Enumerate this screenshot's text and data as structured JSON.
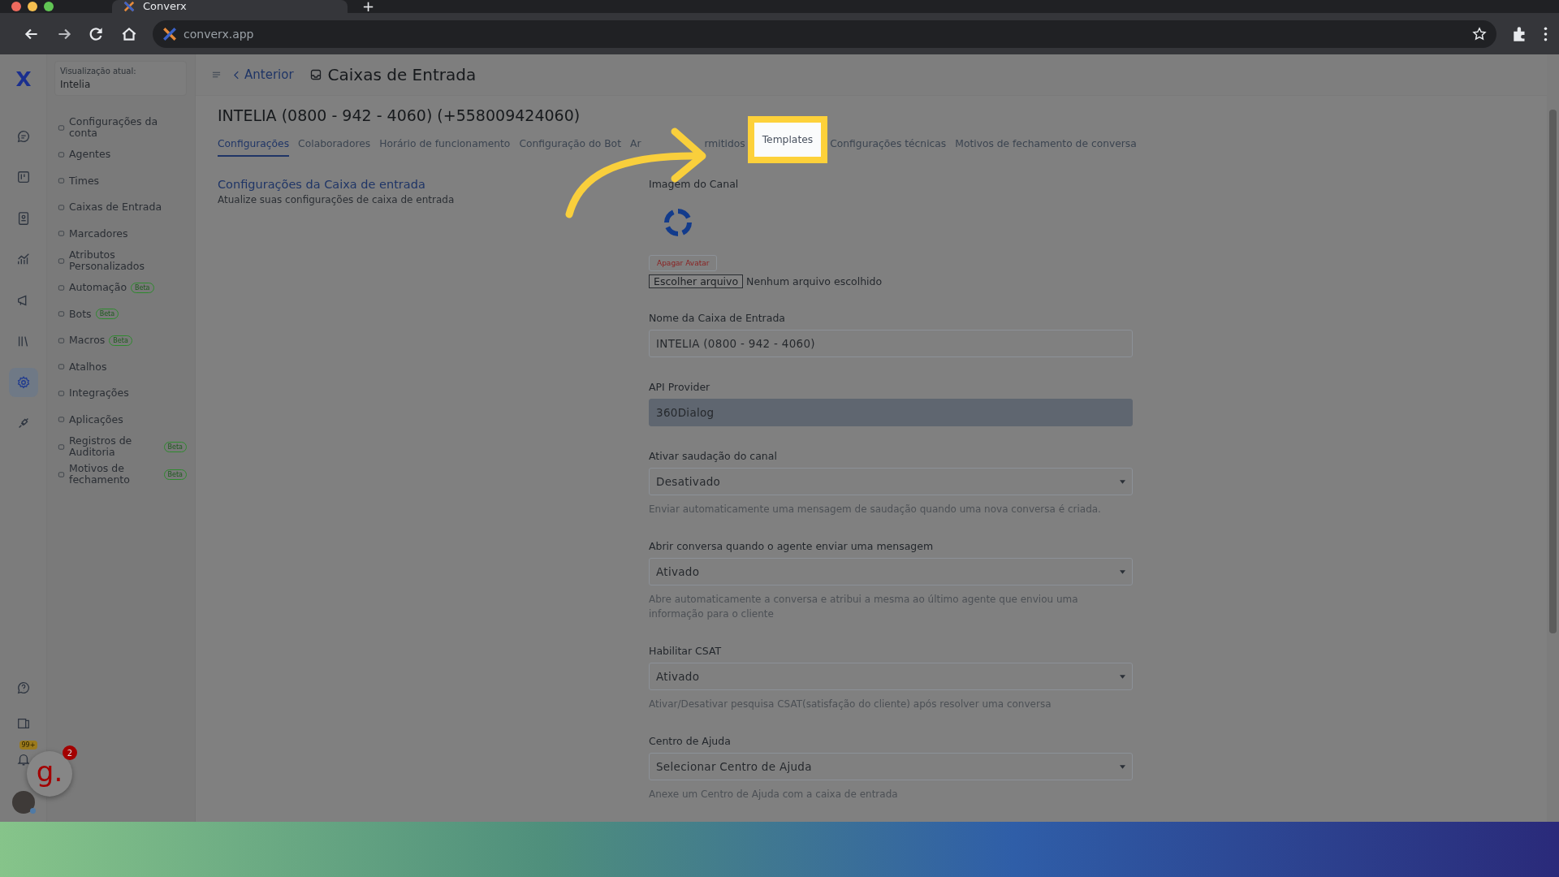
{
  "browser": {
    "tab_title": "Converx",
    "new_tab": "+",
    "url": "converx.app"
  },
  "rail": {
    "items": [
      {
        "selected": false
      },
      {
        "selected": false
      },
      {
        "selected": false
      },
      {
        "selected": false
      },
      {
        "selected": false
      },
      {
        "selected": false
      },
      {
        "selected": true
      },
      {
        "selected": false
      }
    ],
    "notification_badge": "99+"
  },
  "account": {
    "label": "Visualização atual:",
    "name": "Intelia"
  },
  "sidebar": {
    "items": [
      {
        "label": "Configurações da conta"
      },
      {
        "label": "Agentes"
      },
      {
        "label": "Times"
      },
      {
        "label": "Caixas de Entrada"
      },
      {
        "label": "Marcadores"
      },
      {
        "label": "Atributos Personalizados"
      },
      {
        "label": "Automação",
        "badge": "Beta"
      },
      {
        "label": "Bots",
        "badge": "Beta"
      },
      {
        "label": "Macros",
        "badge": "Beta"
      },
      {
        "label": "Atalhos"
      },
      {
        "label": "Integrações"
      },
      {
        "label": "Aplicações"
      },
      {
        "label": "Registros de Auditoria",
        "badge": "Beta"
      },
      {
        "label": "Motivos de fechamento",
        "badge": "Beta"
      }
    ]
  },
  "header": {
    "back": "Anterior",
    "title": "Caixas de Entrada"
  },
  "inbox": {
    "title": "INTELIA (0800 - 942 - 4060) (+558009424060)",
    "tabs": [
      {
        "label": "Configurações",
        "selected": true,
        "highlighted": false
      },
      {
        "label": "Colaboradores",
        "selected": false,
        "highlighted": false
      },
      {
        "label": "Horário de funcionamento",
        "selected": false,
        "highlighted": false
      },
      {
        "label": "Configuração do Bot",
        "selected": false,
        "highlighted": false
      },
      {
        "label_parts": [
          "Ar",
          "rmitidos"
        ],
        "selected": false,
        "highlighted": false
      },
      {
        "label": "Templates",
        "selected": false,
        "highlighted": true
      },
      {
        "label": "Configurações técnicas",
        "selected": false,
        "highlighted": false
      },
      {
        "label": "Motivos de fechamento de conversa",
        "selected": false,
        "highlighted": false
      }
    ]
  },
  "section": {
    "title": "Configurações da Caixa de entrada",
    "description": "Atualize suas configurações de caixa de entrada"
  },
  "form": {
    "image_label": "Imagem do Canal",
    "delete_avatar": "Apagar Avatar",
    "file_button": "Escolher arquivo",
    "file_status": "Nenhum arquivo escolhido",
    "fields": [
      {
        "kind": "text",
        "label": "Nome da Caixa de Entrada",
        "value": "INTELIA (0800 - 942 - 4060)"
      },
      {
        "kind": "readonly",
        "label": "API Provider",
        "value": "360Dialog"
      },
      {
        "kind": "select",
        "label": "Ativar saudação do canal",
        "value": "Desativado",
        "help": "Enviar automaticamente uma mensagem de saudação quando uma nova conversa é criada."
      },
      {
        "kind": "select",
        "label": "Abrir conversa quando o agente enviar uma mensagem",
        "value": "Ativado",
        "help": "Abre automaticamente a conversa e atribui a mesma ao último agente que enviou uma informação para o cliente"
      },
      {
        "kind": "select",
        "label": "Habilitar CSAT",
        "value": "Ativado",
        "help": "Ativar/Desativar pesquisa CSAT(satisfação do cliente) após resolver uma conversa"
      },
      {
        "kind": "select",
        "label": "Centro de Ajuda",
        "value": "Selecionar Centro de Ajuda",
        "help": "Anexe um Centro de Ajuda com a caixa de entrada"
      }
    ]
  },
  "widget": {
    "letter": "g.",
    "badge": "2"
  }
}
